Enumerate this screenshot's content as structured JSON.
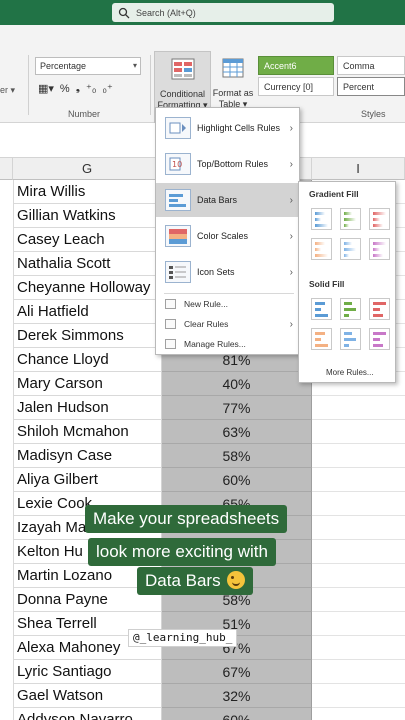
{
  "search": {
    "placeholder": "Search (Alt+Q)"
  },
  "ribbon": {
    "number_format": "Percentage",
    "number_group_label": "Number",
    "styles_group_label": "Styles",
    "conditional_formatting": {
      "line1": "Conditional",
      "line2": "Formatting"
    },
    "format_as_table": {
      "line1": "Format as",
      "line2": "Table"
    },
    "styles": {
      "accent6": "Accent6",
      "comma": "Comma",
      "currency": "Currency [0]",
      "percent": "Percent"
    },
    "accent_color": "#70ad47"
  },
  "columns": {
    "g": "G",
    "i": "I"
  },
  "menu": {
    "items": [
      {
        "label": "Highlight Cells Rules",
        "icon": "highlight-cells-icon"
      },
      {
        "label": "Top/Bottom Rules",
        "icon": "top-bottom-icon"
      },
      {
        "label": "Data Bars",
        "icon": "data-bars-icon"
      },
      {
        "label": "Color Scales",
        "icon": "color-scales-icon"
      },
      {
        "label": "Icon Sets",
        "icon": "icon-sets-icon"
      }
    ],
    "small_items": [
      {
        "label": "New Rule..."
      },
      {
        "label": "Clear Rules"
      },
      {
        "label": "Manage Rules..."
      }
    ]
  },
  "submenu": {
    "gradient_fill": "Gradient Fill",
    "solid_fill": "Solid Fill",
    "more_rules": "More Rules...",
    "bar_colors": [
      "#5b9bd5",
      "#70ad47",
      "#e06666",
      "#f4b183",
      "#7fb2e5",
      "#c878c8"
    ]
  },
  "rows": [
    {
      "name": "Mira Willis",
      "value": ""
    },
    {
      "name": "Gillian Watkins",
      "value": ""
    },
    {
      "name": "Casey Leach",
      "value": ""
    },
    {
      "name": "Nathalia Scott",
      "value": ""
    },
    {
      "name": "Cheyanne Holloway",
      "value": ""
    },
    {
      "name": "Ali Hatfield",
      "value": ""
    },
    {
      "name": "Derek Simmons",
      "value": ""
    },
    {
      "name": "Chance Lloyd",
      "value": "81%"
    },
    {
      "name": "Mary Carson",
      "value": "40%"
    },
    {
      "name": "Jalen Hudson",
      "value": "77%"
    },
    {
      "name": "Shiloh Mcmahon",
      "value": "63%"
    },
    {
      "name": "Madisyn Case",
      "value": "58%"
    },
    {
      "name": "Aliya Gilbert",
      "value": "60%"
    },
    {
      "name": "Lexie Cook",
      "value": "65%"
    },
    {
      "name": "Izayah Ma",
      "value": ""
    },
    {
      "name": "Kelton Hu",
      "value": ""
    },
    {
      "name": "Martin Lozano",
      "value": ""
    },
    {
      "name": "Donna Payne",
      "value": "58%"
    },
    {
      "name": "Shea Terrell",
      "value": "51%"
    },
    {
      "name": "Alexa Mahoney",
      "value": "67%"
    },
    {
      "name": "Lyric Santiago",
      "value": "67%"
    },
    {
      "name": "Gael Watson",
      "value": "32%"
    },
    {
      "name": "Addyson Navarro",
      "value": "60%"
    }
  ],
  "caption": {
    "line1": "Make your spreadsheets",
    "line2": "look more exciting with",
    "line3": "Data Bars"
  },
  "watermark": "@_learning_hub_"
}
